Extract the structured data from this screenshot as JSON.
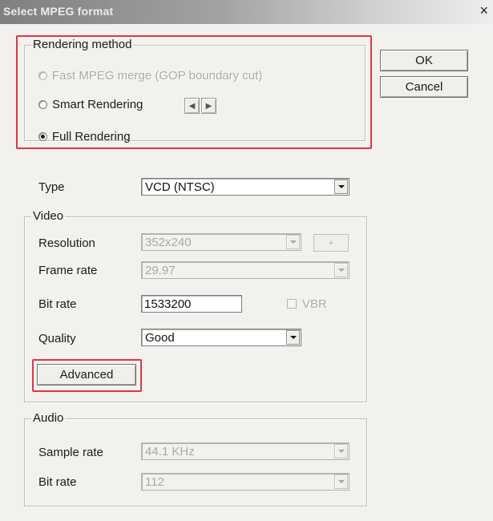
{
  "window": {
    "title": "Select MPEG format",
    "close_glyph": "×"
  },
  "buttons": {
    "ok": "OK",
    "cancel": "Cancel",
    "advanced": "Advanced"
  },
  "rendering": {
    "label": "Rendering method",
    "options": [
      {
        "label": "Fast MPEG merge (GOP boundary cut)",
        "enabled": false,
        "selected": false
      },
      {
        "label": "Smart Rendering",
        "enabled": true,
        "selected": false
      },
      {
        "label": "Full Rendering",
        "enabled": true,
        "selected": true
      }
    ],
    "spin_left_glyph": "◀",
    "spin_right_glyph": "▶"
  },
  "type": {
    "label": "Type",
    "value": "VCD (NTSC)"
  },
  "video": {
    "label": "Video",
    "resolution": {
      "label": "Resolution",
      "value": "352x240",
      "extra_button": "+"
    },
    "frame_rate": {
      "label": "Frame rate",
      "value": "29.97"
    },
    "bit_rate": {
      "label": "Bit rate",
      "value": "1533200"
    },
    "vbr": {
      "label": "VBR",
      "checked": false
    },
    "quality": {
      "label": "Quality",
      "value": "Good"
    }
  },
  "audio": {
    "label": "Audio",
    "sample_rate": {
      "label": "Sample rate",
      "value": "44.1 KHz"
    },
    "bit_rate": {
      "label": "Bit rate",
      "value": "112"
    }
  },
  "colors": {
    "highlight": "#e0344c",
    "dialog_bg": "#f2f1ed",
    "disabled_text": "#a9a9a6"
  },
  "icons": [
    "close-icon",
    "radio-icon",
    "spin-left-icon",
    "spin-right-icon",
    "dropdown-arrow-icon",
    "checkbox-icon"
  ]
}
